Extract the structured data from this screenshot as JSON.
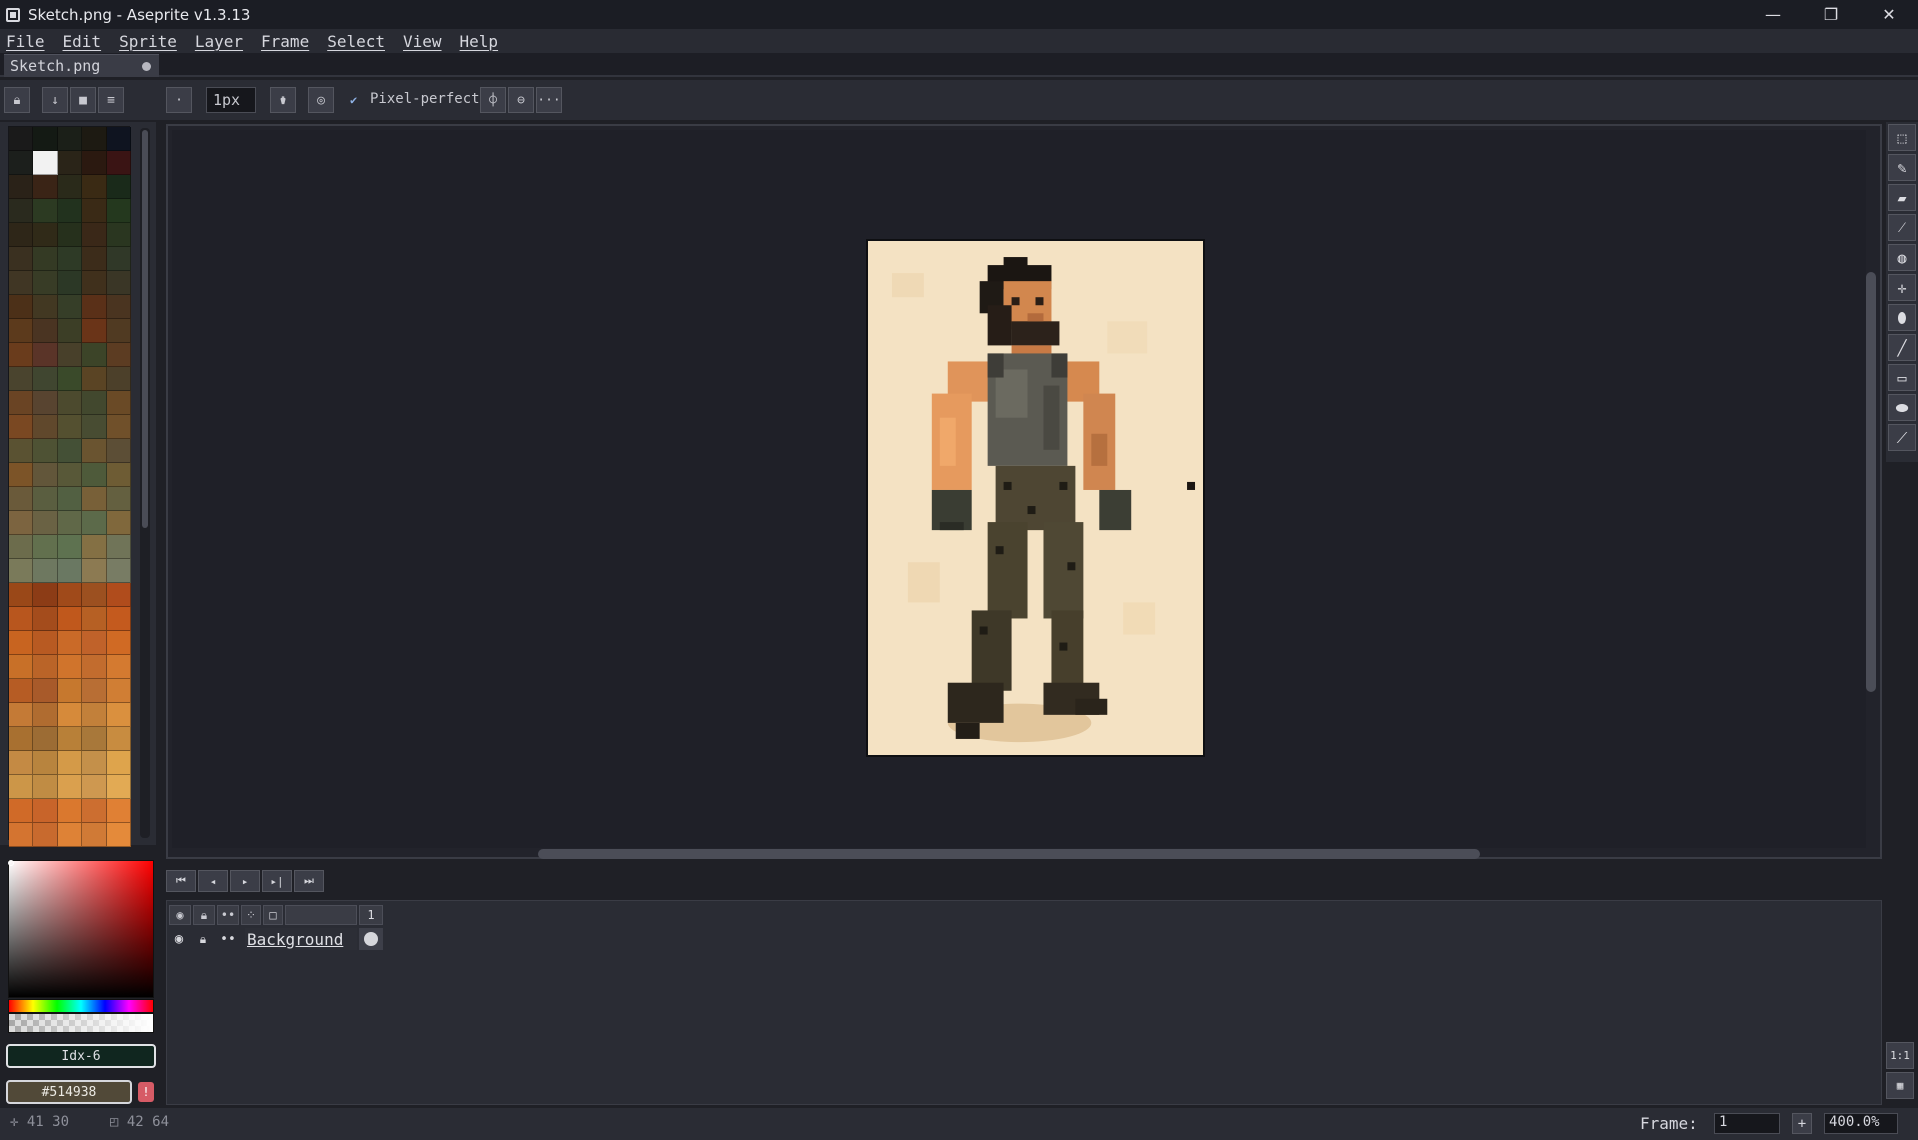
{
  "window": {
    "title": "Sketch.png - Aseprite v1.3.13",
    "minimize": "—",
    "maximize": "❐",
    "close": "✕"
  },
  "menu": [
    "File",
    "Edit",
    "Sprite",
    "Layer",
    "Frame",
    "Select",
    "View",
    "Help"
  ],
  "tab": {
    "label": "Sketch.png"
  },
  "toolbar": {
    "brush_size": "1px",
    "pixel_perfect_label": "Pixel-perfect",
    "pixel_perfect_checked": "✔",
    "more": "···"
  },
  "palette": {
    "colors": [
      "#1a1a1a",
      "#141a14",
      "#1b1f18",
      "#1d1a12",
      "#0f1420",
      "#1c1f1c",
      "#f2f2f2",
      "#2a2418",
      "#2b1910",
      "#3a1414",
      "#2a2218",
      "#3a2416",
      "#2a2a1a",
      "#3a2a14",
      "#1a2a1a",
      "#2a2a1e",
      "#2c3a22",
      "#22321e",
      "#3a2a16",
      "#24381e",
      "#2e2618",
      "#302a18",
      "#26301c",
      "#3a2818",
      "#2a3620",
      "#3a3020",
      "#343a24",
      "#2e3a26",
      "#3c2c1a",
      "#303828",
      "#403624",
      "#383c26",
      "#2c3826",
      "#40301c",
      "#3a3626",
      "#4c3018",
      "#423822",
      "#363e28",
      "#5a3018",
      "#4a3420",
      "#5c3a1c",
      "#4a3422",
      "#3c3e26",
      "#6a3418",
      "#503a22",
      "#6a3c1c",
      "#5a3428",
      "#48402a",
      "#3c4428",
      "#5c3c22",
      "#4a442e",
      "#404630",
      "#3a4a2a",
      "#5a4424",
      "#4c402a",
      "#6a4424",
      "#584430",
      "#4c4a2e",
      "#42482e",
      "#6a4a26",
      "#7a4822",
      "#60482c",
      "#545030",
      "#484c32",
      "#70502a",
      "#5a5232",
      "#4e5234",
      "#445036",
      "#6a5430",
      "#5c4e36",
      "#7c5428",
      "#62563a",
      "#585838",
      "#4e5a3a",
      "#6e5c34",
      "#6a5a3a",
      "#5a5e40",
      "#526042",
      "#786038",
      "#646040",
      "#7c6440",
      "#6a6244",
      "#606848",
      "#5c6a4a",
      "#80683c",
      "#6c6c4c",
      "#62704e",
      "#5e7250",
      "#847044",
      "#707458",
      "#7a7a5a",
      "#6e7860",
      "#6a7862",
      "#8c7a52",
      "#787c64",
      "#9a4818",
      "#8c3c16",
      "#a04a1a",
      "#9c5020",
      "#b04c1c",
      "#b8561e",
      "#a44c1c",
      "#c0581c",
      "#b66024",
      "#c45a1e",
      "#c86420",
      "#b85a22",
      "#ca6a28",
      "#c0622a",
      "#d06a24",
      "#c87028",
      "#ba6428",
      "#d0742c",
      "#c26c2e",
      "#d47a30",
      "#b65c24",
      "#a85a2a",
      "#c6782e",
      "#b86e34",
      "#d07e34",
      "#c47a36",
      "#b06c30",
      "#d68a3a",
      "#c2803a",
      "#da903e",
      "#a87030",
      "#9c6c34",
      "#b88038",
      "#a8783a",
      "#c88c40",
      "#c48a44",
      "#b8843e",
      "#d49a48",
      "#c4904a",
      "#dea44c",
      "#cc9648",
      "#c08c44",
      "#daa04e",
      "#ce9850",
      "#e2aa54",
      "#d06a28",
      "#c8642a",
      "#da782e",
      "#cc6e30",
      "#e08034",
      "#d47430",
      "#c86a2e",
      "#de8236",
      "#d07a36",
      "#e48a3a"
    ]
  },
  "color": {
    "index_label": "Idx-6",
    "hex_label": "#514938",
    "warn": "!"
  },
  "timeline": {
    "frame_number": "1",
    "layer_name": "Background"
  },
  "tools": {
    "fit": "1:1"
  },
  "status": {
    "cursor_pos": "41 30",
    "sprite_size": "42 64",
    "frame_label": "Frame:",
    "frame_value": "1",
    "add_frame": "+",
    "zoom": "400.0%"
  }
}
